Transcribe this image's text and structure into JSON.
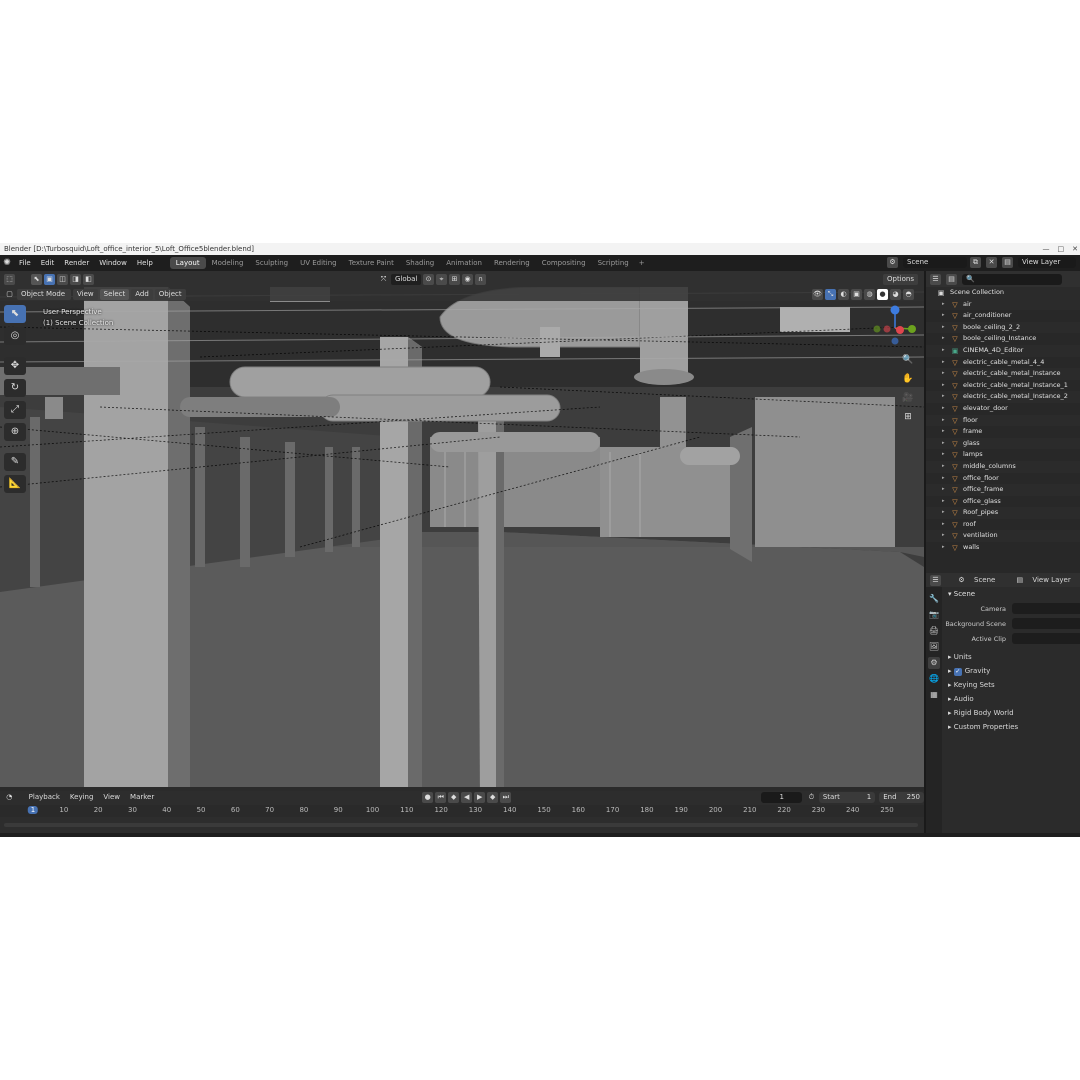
{
  "window": {
    "title": "Blender [D:\\Turbosquid\\Loft_office_interior_5\\Loft_Office5blender.blend]",
    "controls": [
      "—",
      "□",
      "✕"
    ]
  },
  "menubar": {
    "items": [
      "File",
      "Edit",
      "Render",
      "Window",
      "Help"
    ],
    "workspaces": [
      "Layout",
      "Modeling",
      "Sculpting",
      "UV Editing",
      "Texture Paint",
      "Shading",
      "Animation",
      "Rendering",
      "Compositing",
      "Scripting"
    ],
    "active_workspace": "Layout",
    "add_label": "+",
    "scene_label": "Scene",
    "view_layer_label": "View Layer"
  },
  "viewport_header": {
    "mode": "Object Mode",
    "menus": [
      "View",
      "Select",
      "Add",
      "Object"
    ],
    "orientation": "Global",
    "options_label": "Options"
  },
  "viewport": {
    "perspective_label": "User Perspective",
    "collection_label": "(1) Scene Collection",
    "gizmo_axes": {
      "z": "Z",
      "y": "Y",
      "x": "X"
    }
  },
  "outliner": {
    "root": "Scene Collection",
    "items": [
      {
        "name": "air",
        "icon": "mesh"
      },
      {
        "name": "air_conditioner",
        "icon": "mesh"
      },
      {
        "name": "boole_ceiling_2_2",
        "icon": "mesh"
      },
      {
        "name": "boole_ceiling_Instance",
        "icon": "mesh"
      },
      {
        "name": "CINEMA_4D_Editor",
        "icon": "camera"
      },
      {
        "name": "electric_cable_metal_4_4",
        "icon": "mesh"
      },
      {
        "name": "electric_cable_metal_Instance",
        "icon": "mesh"
      },
      {
        "name": "electric_cable_metal_Instance_1",
        "icon": "mesh"
      },
      {
        "name": "electric_cable_metal_Instance_2",
        "icon": "mesh"
      },
      {
        "name": "elevator_door",
        "icon": "mesh"
      },
      {
        "name": "floor",
        "icon": "mesh"
      },
      {
        "name": "frame",
        "icon": "mesh"
      },
      {
        "name": "glass",
        "icon": "mesh"
      },
      {
        "name": "lamps",
        "icon": "mesh"
      },
      {
        "name": "middle_columns",
        "icon": "mesh"
      },
      {
        "name": "office_floor",
        "icon": "mesh"
      },
      {
        "name": "office_frame",
        "icon": "mesh"
      },
      {
        "name": "office_glass",
        "icon": "mesh"
      },
      {
        "name": "Roof_pipes",
        "icon": "mesh"
      },
      {
        "name": "roof",
        "icon": "mesh"
      },
      {
        "name": "ventilation",
        "icon": "mesh"
      },
      {
        "name": "walls",
        "icon": "mesh"
      }
    ]
  },
  "properties": {
    "header_scene": "Scene",
    "header_view_layer": "View Layer",
    "section": "Scene",
    "fields": [
      {
        "label": "Camera"
      },
      {
        "label": "Background Scene"
      },
      {
        "label": "Active Clip"
      }
    ],
    "panels": [
      "Units",
      "Gravity",
      "Keying Sets",
      "Audio",
      "Rigid Body World",
      "Custom Properties"
    ],
    "gravity_checked": true
  },
  "timeline": {
    "menus": [
      "Playback",
      "Keying",
      "View",
      "Marker"
    ],
    "current_frame": "1",
    "start_label": "Start",
    "start": "1",
    "end_label": "End",
    "end": "250",
    "ruler": [
      "1",
      "10",
      "20",
      "30",
      "40",
      "50",
      "60",
      "70",
      "80",
      "90",
      "100",
      "110",
      "120",
      "130",
      "140",
      "150",
      "160",
      "170",
      "180",
      "190",
      "200",
      "210",
      "220",
      "230",
      "240",
      "250"
    ]
  },
  "colors": {
    "accent": "#4772b3",
    "axis_x": "#e0464e",
    "axis_y": "#6ca21e",
    "axis_z": "#3d7ce0",
    "mesh_icon": "#e59a4b",
    "camera_icon": "#48a88a"
  }
}
